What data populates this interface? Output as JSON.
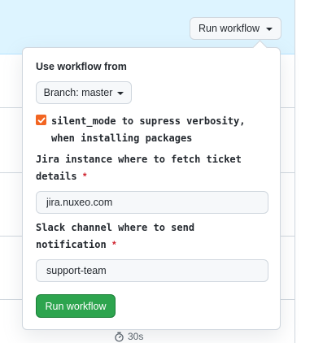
{
  "header": {
    "run_workflow_label": "Run workflow"
  },
  "popover": {
    "use_workflow_from": "Use workflow from",
    "branch_label": "Branch: master",
    "silent_mode": {
      "checked": true,
      "label_line1": "silent_mode to supress verbosity,",
      "label_line2": "when installing packages"
    },
    "jira": {
      "label_line1": "Jira instance where to fetch ticket",
      "label_line2": "details",
      "required_mark": "*",
      "value": "jira.nuxeo.com"
    },
    "slack": {
      "label_line1": "Slack channel where to send",
      "label_line2": "notification",
      "required_mark": "*",
      "value": "support-team"
    },
    "submit_label": "Run workflow"
  },
  "background_row": {
    "duration": "30s"
  },
  "colors": {
    "highlight_row": "#ddf4ff",
    "primary_button": "#2da44e",
    "checkbox": "#f26522",
    "required": "#cf222e"
  }
}
